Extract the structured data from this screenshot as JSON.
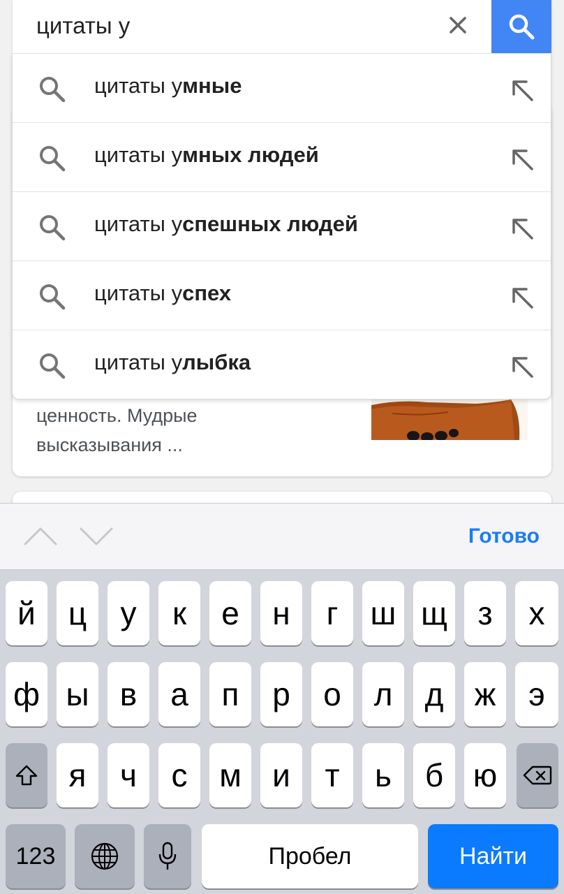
{
  "search": {
    "query": "цитаты у"
  },
  "suggestions": [
    {
      "prefix": "цитаты у",
      "completion": "мные"
    },
    {
      "prefix": "цитаты у",
      "completion": "мных людей"
    },
    {
      "prefix": "цитаты у",
      "completion": "спешных людей"
    },
    {
      "prefix": "цитаты у",
      "completion": "спех"
    },
    {
      "prefix": "цитаты у",
      "completion": "лыбка"
    }
  ],
  "result": {
    "snippet_line1": "ценность. Мудрые",
    "snippet_line2": "высказывания ..."
  },
  "accessory": {
    "done_label": "Готово"
  },
  "keyboard": {
    "row1": [
      "й",
      "ц",
      "у",
      "к",
      "е",
      "н",
      "г",
      "ш",
      "щ",
      "з",
      "х"
    ],
    "row2": [
      "ф",
      "ы",
      "в",
      "а",
      "п",
      "р",
      "о",
      "л",
      "д",
      "ж",
      "э"
    ],
    "row3": [
      "я",
      "ч",
      "с",
      "м",
      "и",
      "т",
      "ь",
      "б",
      "ю"
    ],
    "numbers_label": "123",
    "space_label": "Пробел",
    "go_label": "Найти"
  },
  "colors": {
    "search_button": "#4285f4",
    "done_text": "#1a7cf5",
    "go_key": "#0a7aff"
  }
}
